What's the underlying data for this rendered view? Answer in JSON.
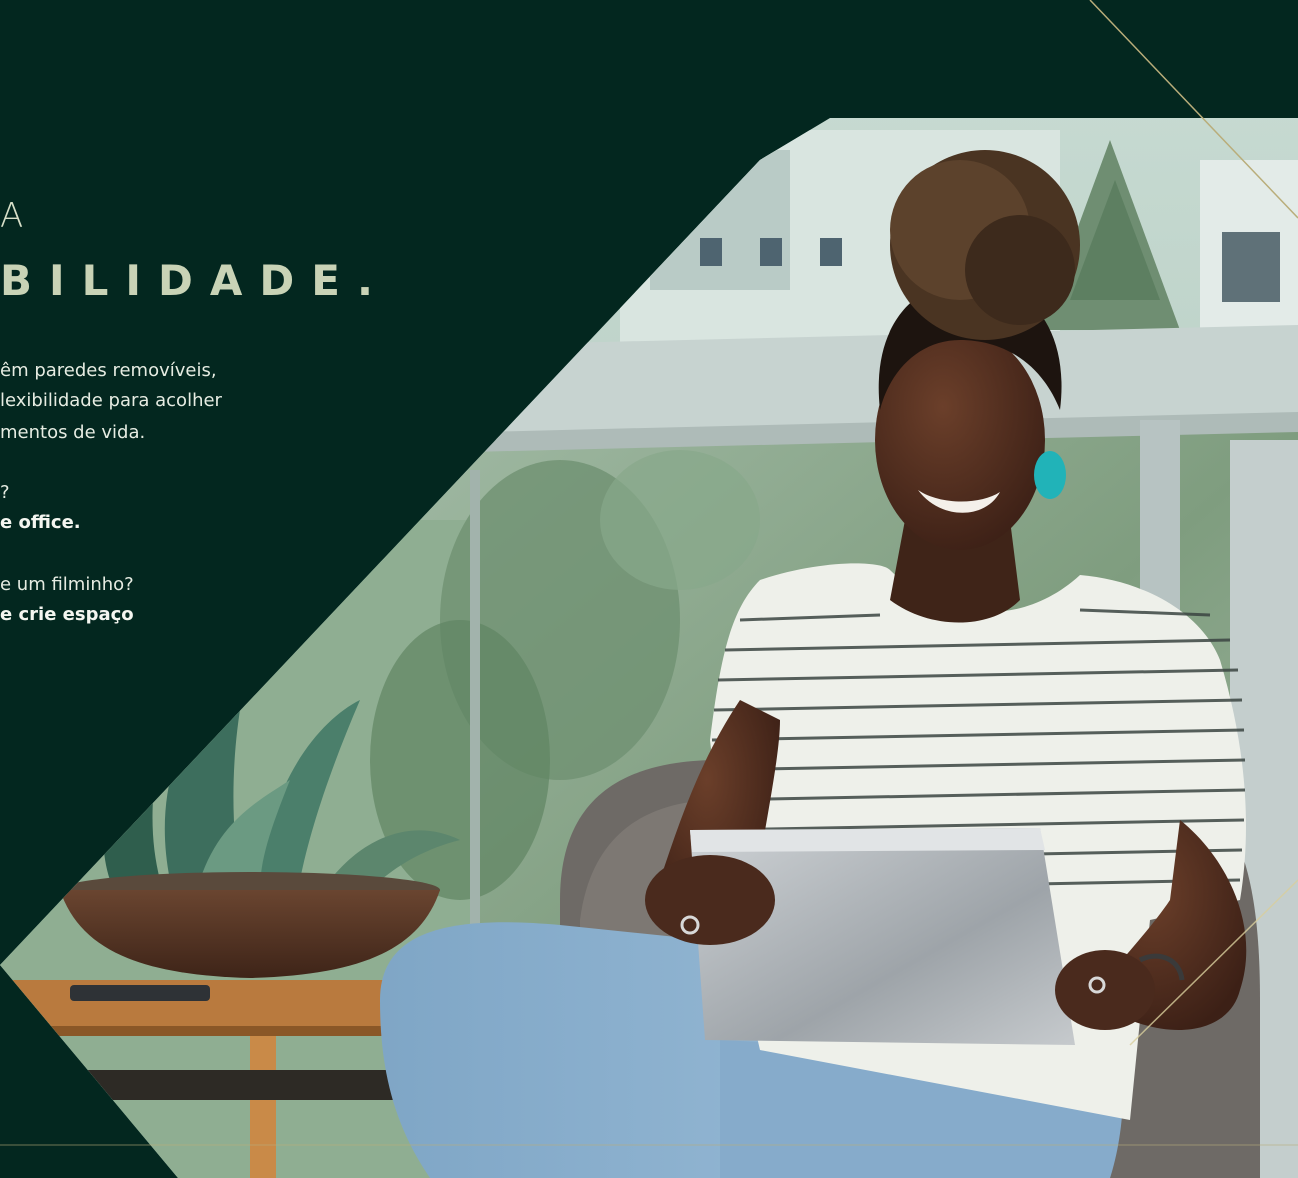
{
  "heading": {
    "line1": "A",
    "line2": "BILIDADE."
  },
  "paragraph1": [
    "êm paredes removíveis,",
    "lexibilidade para acolher",
    "mentos de vida."
  ],
  "paragraph2": {
    "question": "?",
    "answer": "e office."
  },
  "paragraph3": {
    "question": "e um filminho?",
    "answer": "e crie espaço"
  },
  "colors": {
    "background": "#03271f",
    "heading": "#c9d3b6",
    "accent_line": "#b9ad7a"
  },
  "photo": {
    "subject": "woman-with-laptop-on-balcony"
  }
}
